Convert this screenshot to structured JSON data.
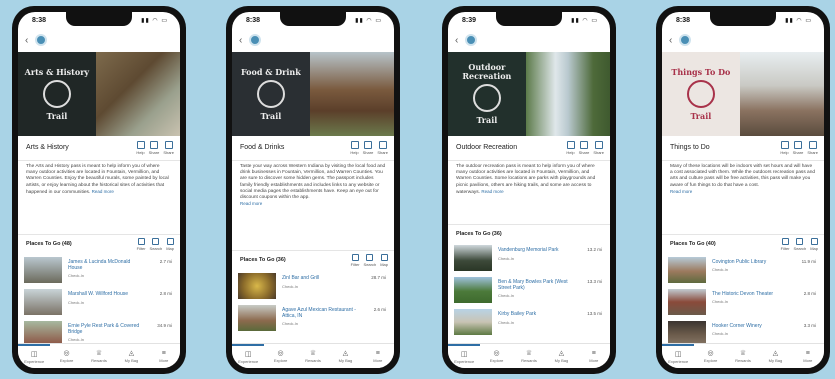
{
  "tabs": [
    "Experience",
    "Explore",
    "Rewards",
    "My Bag",
    "More"
  ],
  "actions": [
    "Help",
    "Share",
    "Share"
  ],
  "place_actions": [
    "Filter",
    "Search",
    "Map"
  ],
  "more_link": "Read more",
  "phones": [
    {
      "time": "8:38",
      "badge_top": "Arts & History",
      "badge_bottom": "Trail",
      "title": "Arts & History",
      "desc": "The Arts and History pass is meant to help inform you of where many outdoor activities are located in Fountain, Vermillion, and Warren Counties. Enjoy the beautiful murals, some painted by local artists, or enjoy learning about the historical sites of activities that happened in our communities.",
      "places_label": "Places To Go (48)",
      "items": [
        {
          "name": "James & Lucinda McDonald House",
          "check": "Check-In",
          "dist": "2.7 mi"
        },
        {
          "name": "Marshall W. Willford House",
          "check": "Check-In",
          "dist": "2.8 mi"
        },
        {
          "name": "Ernie Pyle Rest Park & Covered Bridge",
          "check": "Check-In",
          "dist": "34.9 mi"
        }
      ]
    },
    {
      "time": "8:38",
      "badge_top": "Food & Drink",
      "badge_bottom": "Trail",
      "title": "Food & Drinks",
      "desc": "Taste your way across Western Indiana by visiting the local food and drink businesses in Fountain, Vermillion, and Warren Counties. You are sure to discover some hidden gems. The passport includes family friendly establishments and includes links to any website or social media pages the establishments have. Keep an eye out for discount coupons within the app.",
      "places_label": "Places To Go (36)",
      "items": [
        {
          "name": "Zinl Bar and Grill",
          "check": "Check-In",
          "dist": "28.7 mi"
        },
        {
          "name": "Agave Azul Mexican Restaurant - Attica, IN",
          "check": "Check-In",
          "dist": "2.6 mi"
        }
      ]
    },
    {
      "time": "8:39",
      "badge_top": "Outdoor Recreation",
      "badge_bottom": "Trail",
      "title": "Outdoor Recreation",
      "desc": "The outdoor recreation pass is meant to help inform you of where many outdoor activities are located in Fountain, Vermillion, and Warren Counties. Some locations are parks with playgrounds and picnic pavilions, others are hiking trails, and some are access to waterways.",
      "places_label": "Places To Go (36)",
      "items": [
        {
          "name": "Vandenburg Memorial Park",
          "check": "Check-In",
          "dist": "13.2 mi"
        },
        {
          "name": "Ben & Mary Bowles Park (West Street Park)",
          "check": "Check-In",
          "dist": "13.3 mi"
        },
        {
          "name": "Kirby Bailey Park",
          "check": "Check-In",
          "dist": "13.5 mi"
        }
      ]
    },
    {
      "time": "8:38",
      "badge_top": "Things To Do",
      "badge_bottom": "Trail",
      "title": "Things to Do",
      "desc": "Many of these locations will be indoors with set hours and will have a cost associated with them. While the outdoors recreation pass and arts and culture pass will be free activities, this pass will make you aware of fun things to do that have a cost.",
      "places_label": "Places To Go (40)",
      "items": [
        {
          "name": "Covington Public Library",
          "check": "Check-In",
          "dist": "11.9 mi"
        },
        {
          "name": "The Historic Devon Theater",
          "check": "Check-In",
          "dist": "2.8 mi"
        },
        {
          "name": "Hooker Corner Winery",
          "check": "Check-In",
          "dist": "3.3 mi"
        }
      ]
    }
  ],
  "colors": {
    "background": "#a9d3e6",
    "link": "#2e6ea5",
    "phone_frame": "#111111"
  }
}
